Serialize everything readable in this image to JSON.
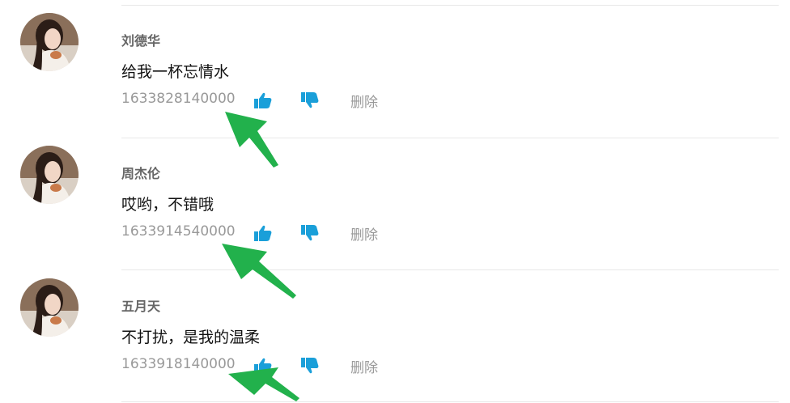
{
  "comments": [
    {
      "author": "刘德华",
      "content": "给我一杯忘情水",
      "timestamp": "1633828140000",
      "delete_label": "删除"
    },
    {
      "author": "周杰伦",
      "content": "哎哟，不错哦",
      "timestamp": "1633914540000",
      "delete_label": "删除"
    },
    {
      "author": "五月天",
      "content": "不打扰，是我的温柔",
      "timestamp": "1633918140000",
      "delete_label": "删除"
    }
  ],
  "colors": {
    "action_icon": "#1a9fd9",
    "annotation_arrow": "#22b14c",
    "muted_text": "#999999",
    "author_text": "#666666"
  },
  "icons": {
    "like": "thumbs-up-icon",
    "dislike": "thumbs-down-icon",
    "annotation": "arrow-icon"
  }
}
